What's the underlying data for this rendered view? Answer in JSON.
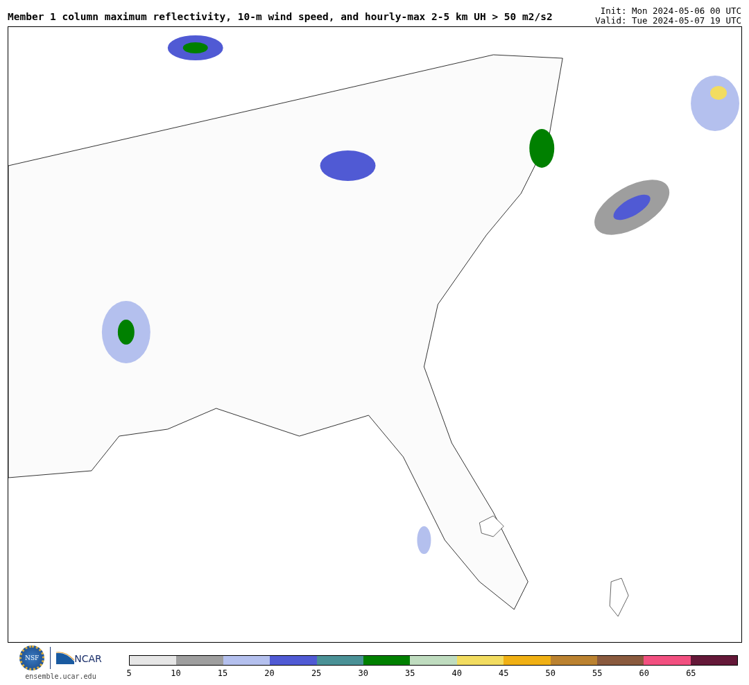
{
  "title": "Member 1 column maximum reflectivity, 10-m wind speed, and hourly-max 2-5 km UH > 50 m2/s2",
  "init": "Init: Mon 2024-05-06 00 UTC",
  "valid": "Valid: Tue 2024-05-07 19 UTC",
  "logo": {
    "seal": "NSF",
    "brand": "NCAR",
    "site": "ensemble.ucar.edu"
  },
  "colorbar": {
    "segments": [
      {
        "color": "#e6e6e6"
      },
      {
        "color": "#9e9e9e"
      },
      {
        "color": "#b4c0ee"
      },
      {
        "color": "#505ad4"
      },
      {
        "color": "#4a9196"
      },
      {
        "color": "#008000"
      },
      {
        "color": "#bfdcbf"
      },
      {
        "color": "#f2dc60"
      },
      {
        "color": "#f0b014"
      },
      {
        "color": "#bb8230"
      },
      {
        "color": "#8a5a3e"
      },
      {
        "color": "#f25080"
      },
      {
        "color": "#641838"
      }
    ],
    "ticks": [
      "5",
      "10",
      "15",
      "20",
      "25",
      "30",
      "35",
      "40",
      "45",
      "50",
      "55",
      "60",
      "65"
    ]
  }
}
